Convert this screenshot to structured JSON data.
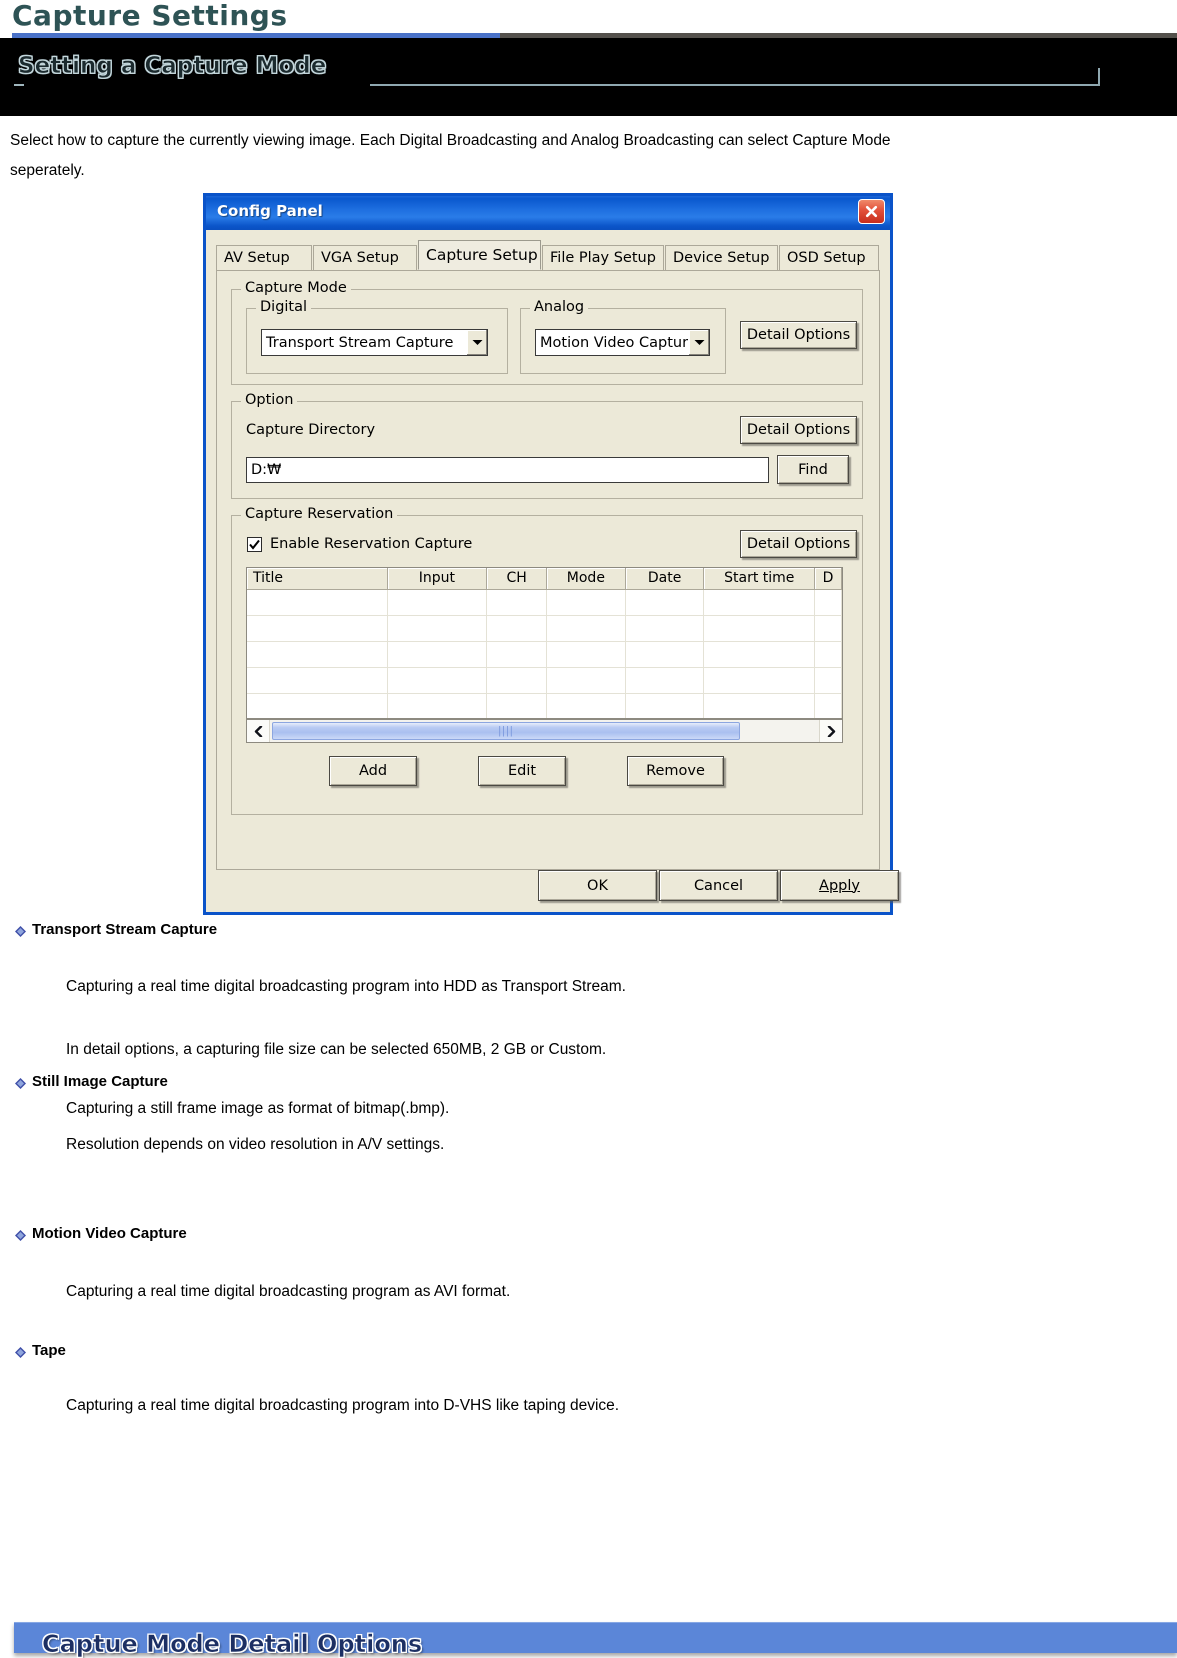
{
  "page": {
    "title": "Capture Settings",
    "section_title": "Setting a Capture Mode",
    "intro_line1": "Select how to capture the currently viewing image.   Each Digital Broadcasting and Analog Broadcasting can select Capture Mode",
    "intro_line2": "seperately.",
    "footer_banner": "Captue Mode Detail Options"
  },
  "colors": {
    "header_text": "#2e5355",
    "header_rule": "#4a72c8",
    "header_rule_dark": "#54514c",
    "band_bg": "#000000",
    "dialog_border": "#0a53c9",
    "dialog_face": "#ece9d8",
    "titlebar": "#1b66d6",
    "close_button": "#c62d1d",
    "scroll_thumb": "#aac0f0",
    "footer_banner": "#5b86d8"
  },
  "dialog": {
    "title": "Config Panel",
    "close_icon": "close-icon",
    "tabs": [
      {
        "label": "AV Setup",
        "active": false
      },
      {
        "label": "VGA Setup",
        "active": false
      },
      {
        "label": "Capture Setup",
        "active": true
      },
      {
        "label": "File Play Setup",
        "active": false
      },
      {
        "label": "Device Setup",
        "active": false
      },
      {
        "label": "OSD Setup",
        "active": false
      }
    ],
    "capture_mode": {
      "legend": "Capture Mode",
      "digital": {
        "legend": "Digital",
        "value": "Transport Stream Capture",
        "arrow_icon": "chevron-down-icon"
      },
      "analog": {
        "legend": "Analog",
        "value": "Motion Video Capture",
        "arrow_icon": "chevron-down-icon"
      },
      "detail_options_label": "Detail Options"
    },
    "option": {
      "legend": "Option",
      "capture_directory_label": "Capture Directory",
      "detail_options_label": "Detail Options",
      "directory_value": "D:₩",
      "find_label": "Find"
    },
    "reservation": {
      "legend": "Capture Reservation",
      "enable_label": "Enable Reservation Capture",
      "enable_checked": true,
      "check_icon": "checkmark-icon",
      "detail_options_label": "Detail Options",
      "columns": [
        "Title",
        "Input",
        "CH",
        "Mode",
        "Date",
        "Start time",
        "D"
      ],
      "rows": [],
      "empty_row_count": 6,
      "scroll_left_icon": "chevron-left-icon",
      "scroll_right_icon": "chevron-right-icon",
      "buttons": [
        "Add",
        "Edit",
        "Remove"
      ]
    },
    "footer_buttons": [
      {
        "label": "OK",
        "accel": ""
      },
      {
        "label": "Cancel",
        "accel": ""
      },
      {
        "label": "Apply",
        "accel": "A"
      }
    ]
  },
  "bullets": [
    {
      "heading": "Transport Stream Capture",
      "lines": [
        "Capturing a real time digital broadcasting program into HDD as Transport Stream.",
        "In detail options, a capturing file size can be selected 650MB, 2 GB or Custom."
      ]
    },
    {
      "heading": "Still Image Capture",
      "lines": [
        "Capturing a still frame image as format of bitmap(.bmp).",
        "Resolution depends on video resolution in A/V settings."
      ]
    },
    {
      "heading": "Motion Video Capture",
      "lines": [
        "Capturing a real time digital broadcasting program as AVI format."
      ]
    },
    {
      "heading": "Tape",
      "lines": [
        "Capturing a real time digital broadcasting program into D-VHS like taping device."
      ]
    }
  ]
}
